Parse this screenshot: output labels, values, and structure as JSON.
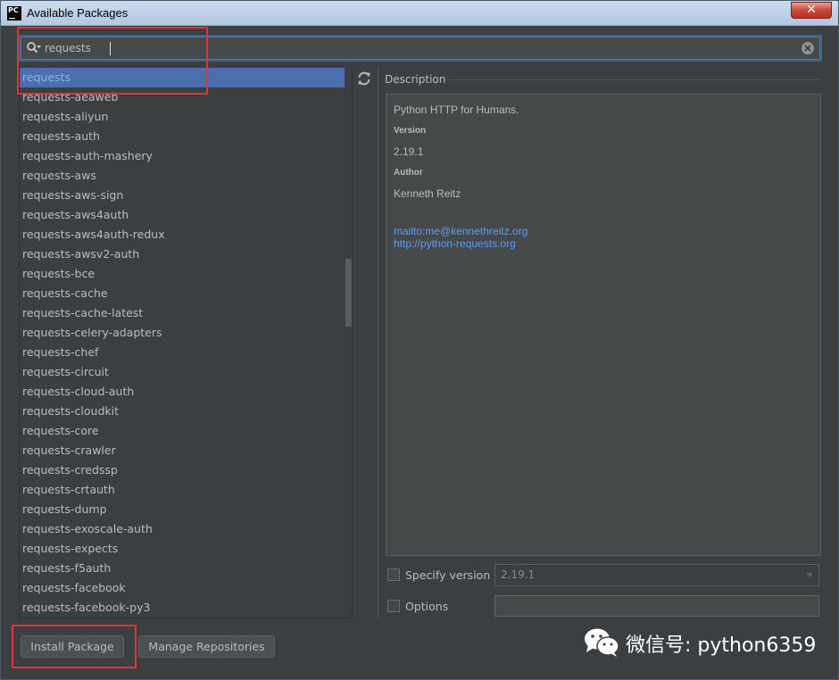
{
  "window": {
    "title": "Available Packages",
    "app_icon_text": "PC",
    "close_label": "✕"
  },
  "search": {
    "value": "requests",
    "placeholder": ""
  },
  "packages": [
    "requests",
    "requests-aeaweb",
    "requests-aliyun",
    "requests-auth",
    "requests-auth-mashery",
    "requests-aws",
    "requests-aws-sign",
    "requests-aws4auth",
    "requests-aws4auth-redux",
    "requests-awsv2-auth",
    "requests-bce",
    "requests-cache",
    "requests-cache-latest",
    "requests-celery-adapters",
    "requests-chef",
    "requests-circuit",
    "requests-cloud-auth",
    "requests-cloudkit",
    "requests-core",
    "requests-crawler",
    "requests-credssp",
    "requests-crtauth",
    "requests-dump",
    "requests-exoscale-auth",
    "requests-expects",
    "requests-f5auth",
    "requests-facebook",
    "requests-facebook-py3"
  ],
  "selected_package": "requests",
  "description": {
    "section_label": "Description",
    "summary": "Python HTTP for Humans.",
    "version_heading": "Version",
    "version": "2.19.1",
    "author_heading": "Author",
    "author": "Kenneth Reitz",
    "email_link": "mailto:me@kennethreitz.org",
    "home_link": "http://python-requests.org"
  },
  "options": {
    "specify_version_label": "Specify version",
    "specify_version_value": "2.19.1",
    "options_label": "Options",
    "options_value": ""
  },
  "buttons": {
    "install": "Install Package",
    "manage": "Manage Repositories"
  },
  "watermark": {
    "text": "微信号: python6359"
  },
  "colors": {
    "background": "#3c3f41",
    "selection": "#4b6eaf",
    "link": "#589df6",
    "highlight_box": "#e3323a"
  }
}
